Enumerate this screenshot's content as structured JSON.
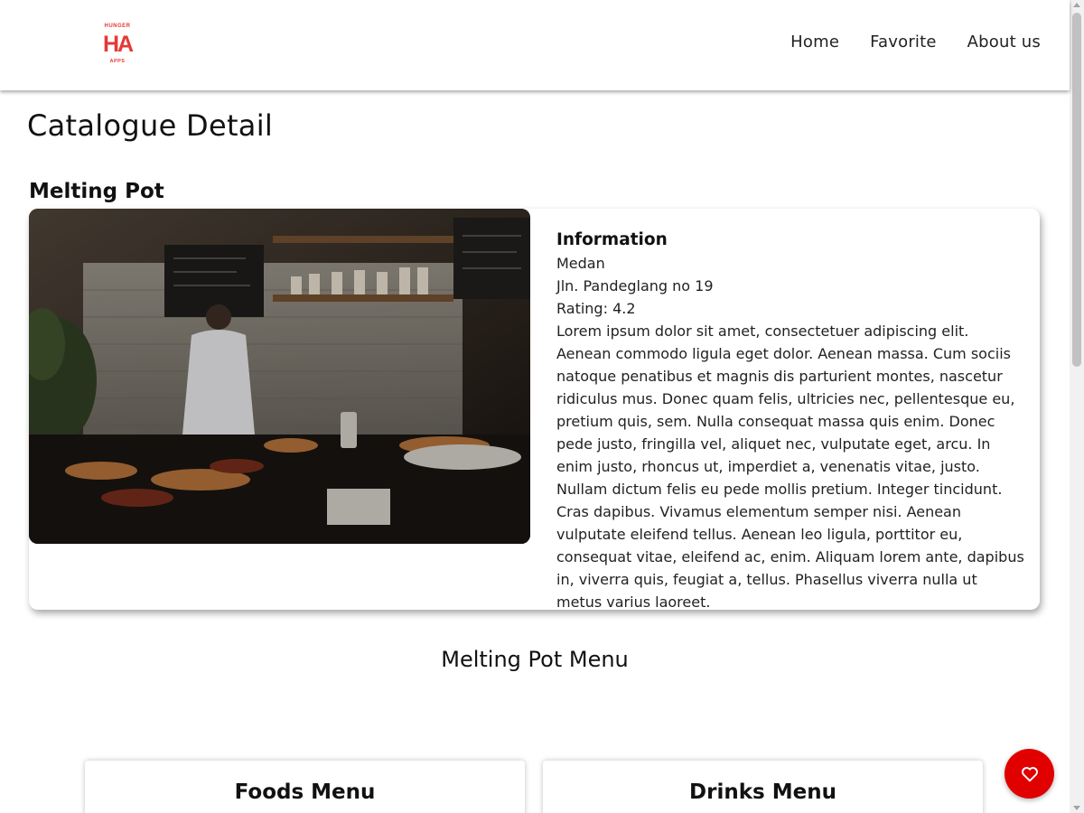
{
  "brand": {
    "logo_text": "HA",
    "logo_top_text": "HUNGER",
    "logo_bottom_text": "APPS",
    "accent_color": "#e53935"
  },
  "nav": {
    "items": [
      {
        "label": "Home"
      },
      {
        "label": "Favorite"
      },
      {
        "label": "About us"
      }
    ]
  },
  "page": {
    "title": "Catalogue Detail"
  },
  "restaurant": {
    "name": "Melting Pot",
    "info_heading": "Information",
    "city": "Medan",
    "address": "Jln. Pandeglang no 19",
    "rating": "Rating: 4.2",
    "description": "Lorem ipsum dolor sit amet, consectetuer adipiscing elit. Aenean commodo ligula eget dolor. Aenean massa. Cum sociis natoque penatibus et magnis dis parturient montes, nascetur ridiculus mus. Donec quam felis, ultricies nec, pellentesque eu, pretium quis, sem. Nulla consequat massa quis enim. Donec pede justo, fringilla vel, aliquet nec, vulputate eget, arcu. In enim justo, rhoncus ut, imperdiet a, venenatis vitae, justo. Nullam dictum felis eu pede mollis pretium. Integer tincidunt. Cras dapibus. Vivamus elementum semper nisi. Aenean vulputate eleifend tellus. Aenean leo ligula, porttitor eu, consequat vitae, eleifend ac, enim. Aliquam lorem ante, dapibus in, viverra quis, feugiat a, tellus. Phasellus viverra nulla ut metus varius laoreet."
  },
  "menu": {
    "title": "Melting Pot Menu",
    "foods_title": "Foods Menu",
    "drinks_title": "Drinks Menu"
  },
  "fab": {
    "icon": "heart-icon",
    "color": "#e00000"
  }
}
